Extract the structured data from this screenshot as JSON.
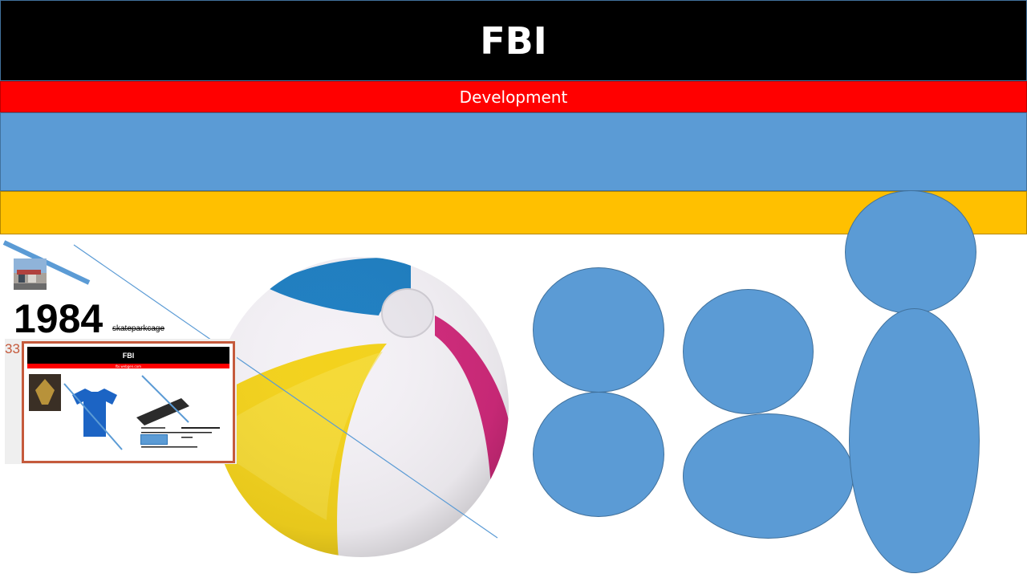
{
  "slide": {
    "title": "FBI",
    "subtitle": "Development"
  },
  "year_block": {
    "year": "1984",
    "caption": "skateparkcage"
  },
  "preview": {
    "partial_number": "33",
    "mini_title": "FBI",
    "mini_subtitle": "fbi.webgen.com"
  },
  "colors": {
    "title_band": "#000000",
    "subtitle_band": "#ff0000",
    "blue_band": "#5b9bd5",
    "yellow_band": "#ffc000",
    "shape_fill": "#5b9bd5",
    "shape_outline": "#41719c"
  }
}
